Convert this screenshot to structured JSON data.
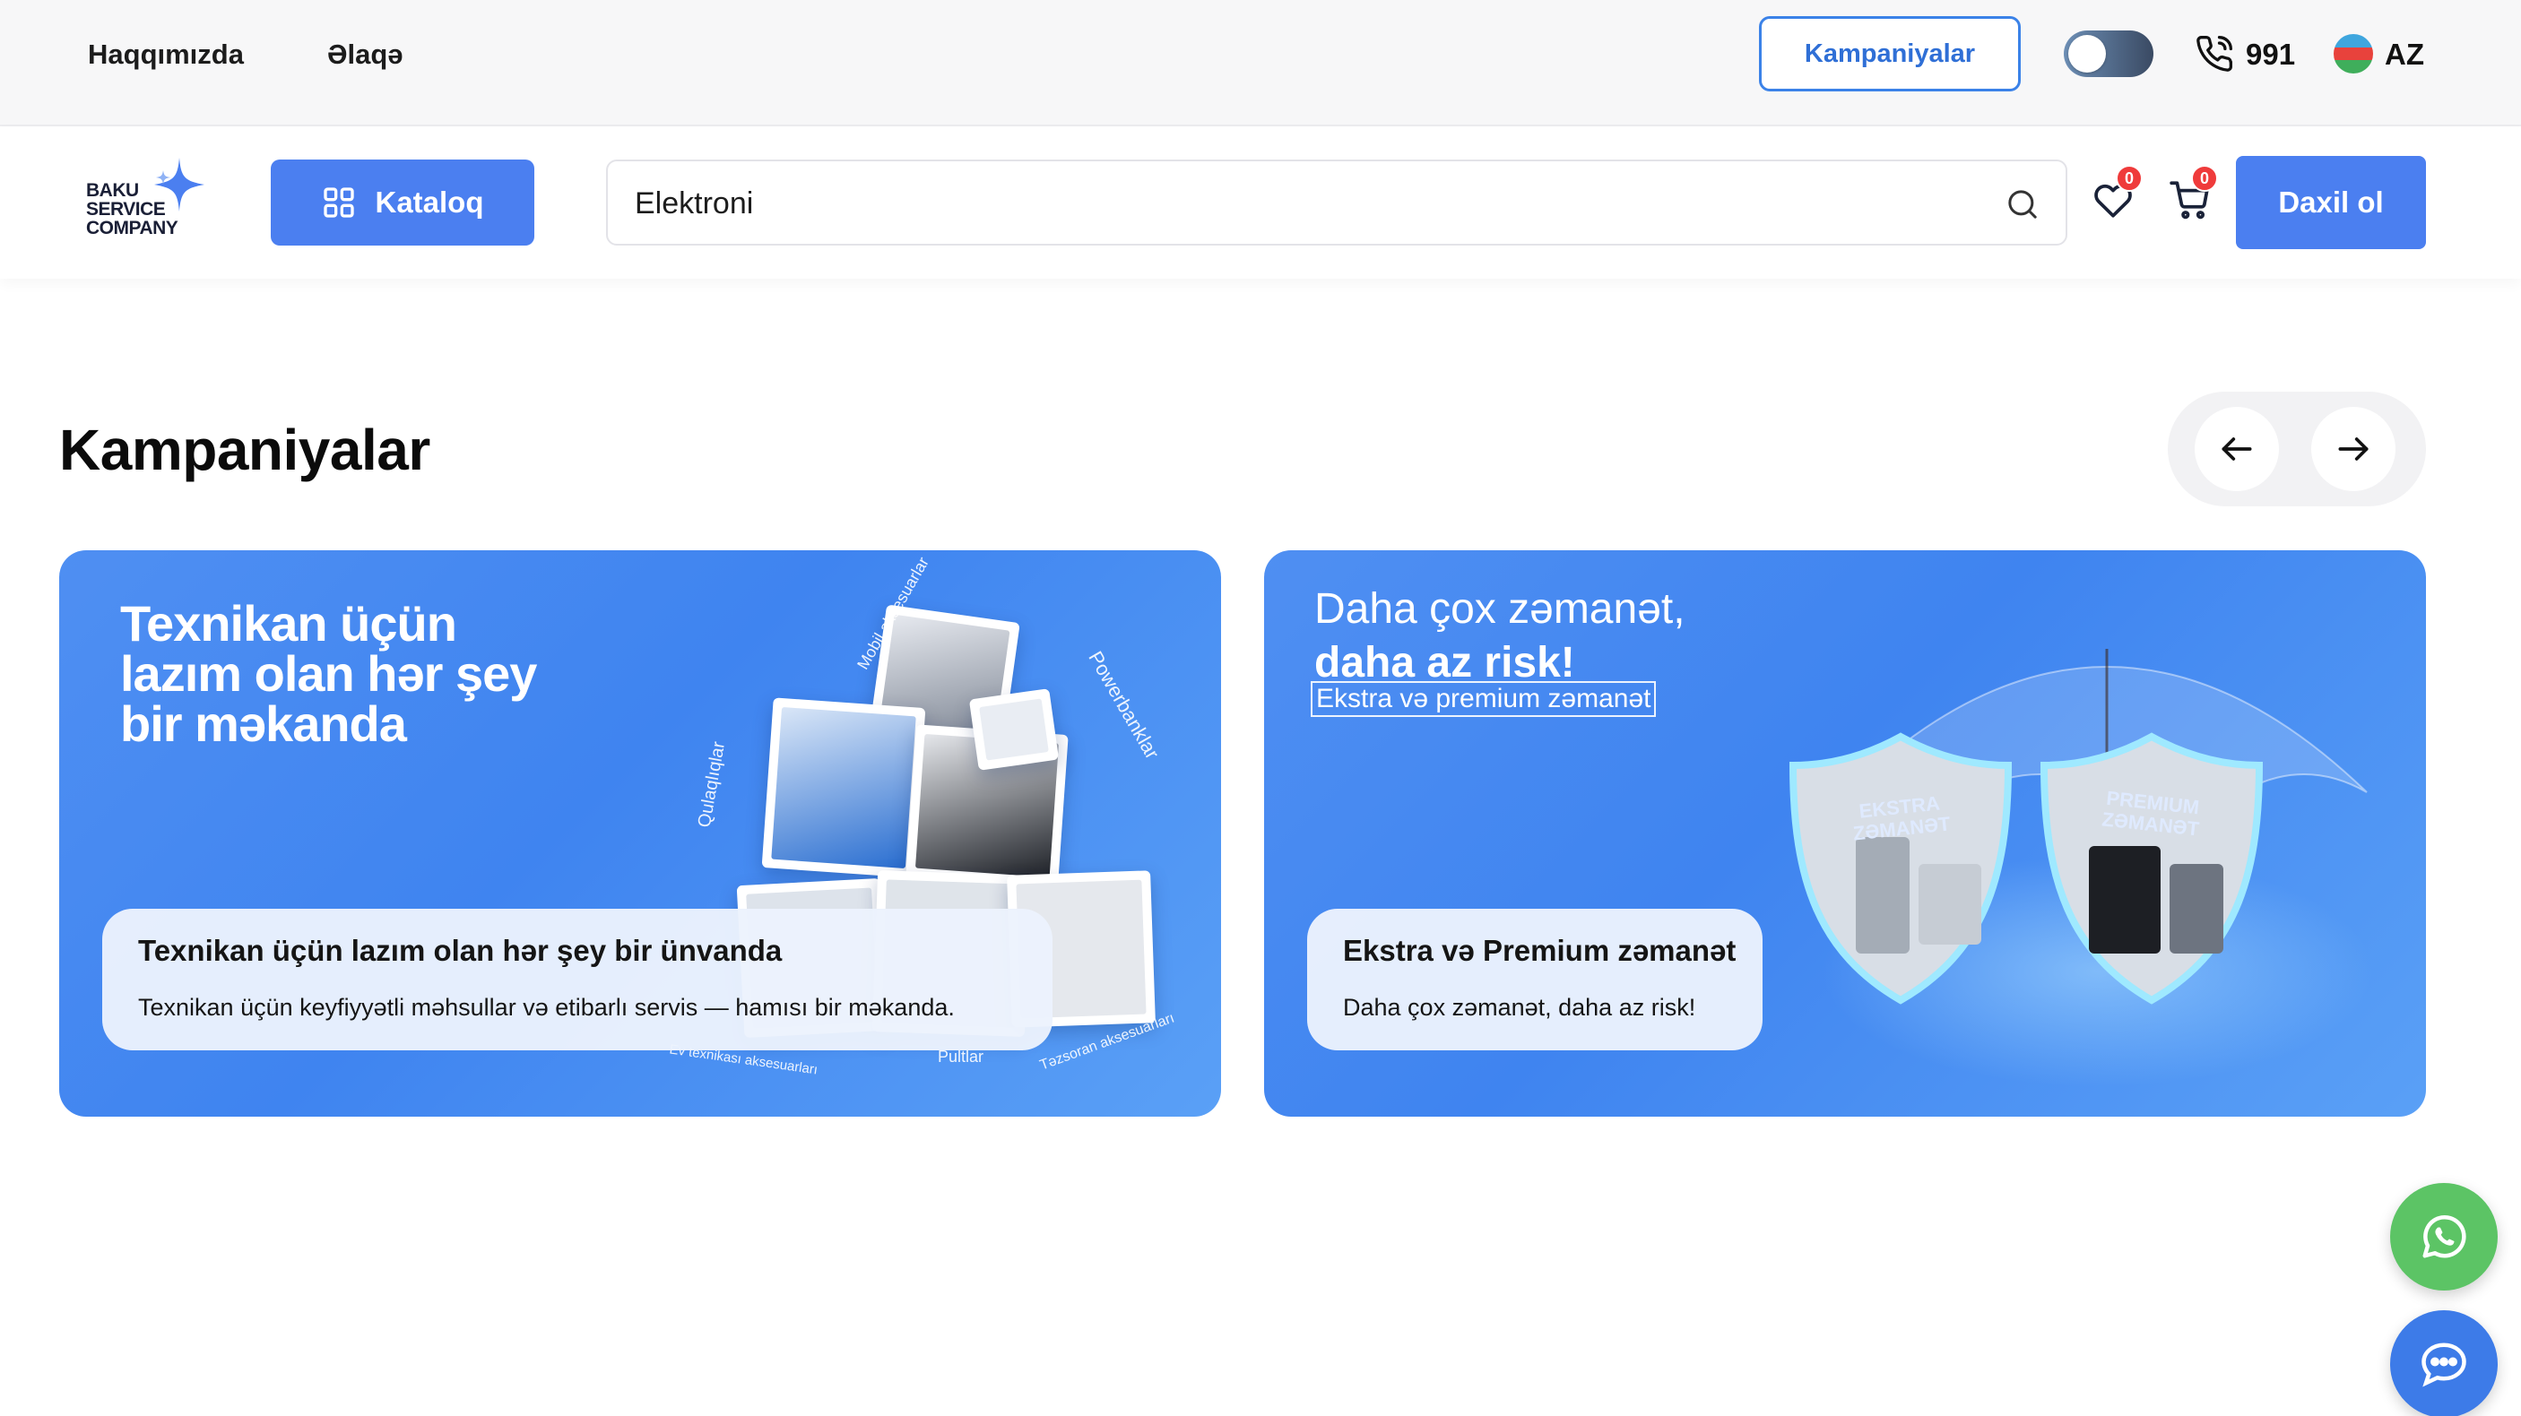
{
  "topbar": {
    "links": [
      "Haqqımızda",
      "Əlaqə"
    ],
    "campaigns_button": "Kampaniyalar",
    "phone": "991",
    "language": "AZ"
  },
  "header": {
    "logo_lines": [
      "BAKU",
      "SERVICE",
      "COMPANY"
    ],
    "catalog_button": "Kataloq",
    "search_value": "Elektroni",
    "favorites_count": "0",
    "cart_count": "0",
    "login_button": "Daxil ol"
  },
  "section": {
    "title": "Kampaniyalar"
  },
  "cards": [
    {
      "heading_lines": [
        "Texnikan üçün",
        "lazım olan hər şey",
        "bir məkanda"
      ],
      "collage_labels": [
        "Mobil aksesuarlar",
        "Powerbanklar",
        "Qulaqlıqlar",
        "Pultlar",
        "Ev texnikası aksesuarları",
        "Təzsoran aksesuarları"
      ],
      "caption_title": "Texnikan üçün lazım olan hər şey bir ünvanda",
      "caption_text": "Texnikan üçün keyfiyyətli məhsullar və etibarlı servis — hamısı bir məkanda."
    },
    {
      "heading_line1": "Daha çox zəmanət,",
      "heading_line2": "daha az risk!",
      "heading_tag": "Ekstra və premium zəmanət",
      "shield_labels": [
        "EKSTRA ZƏMANƏT",
        "PREMIUM ZƏMANƏT"
      ],
      "caption_title": "Ekstra və Premium zəmanət",
      "caption_text": "Daha çox zəmanət, daha az risk!"
    }
  ],
  "colors": {
    "primary": "#4b7ff0",
    "card_blue": "#3f84f0",
    "badge_red": "#ef3b3b",
    "whatsapp_green": "#5cc465",
    "chat_blue": "#3d7be8"
  },
  "icons": [
    "grid-icon",
    "search-icon",
    "heart-icon",
    "cart-icon",
    "phone-icon",
    "arrow-left-icon",
    "arrow-right-icon",
    "whatsapp-icon",
    "chat-icon"
  ]
}
